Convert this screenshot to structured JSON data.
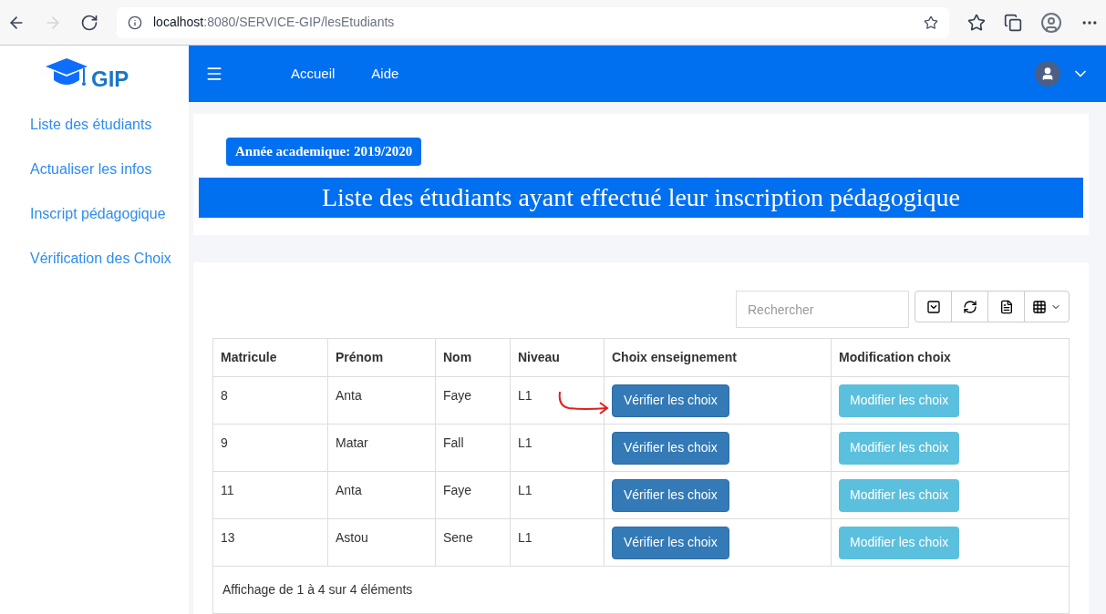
{
  "browser": {
    "url_host": "localhost",
    "url_rest": ":8080/SERVICE-GIP/lesEtudiants"
  },
  "logo": {
    "text": "GIP"
  },
  "sidebar": {
    "items": [
      {
        "label": "Liste des étudiants"
      },
      {
        "label": "Actualiser les infos"
      },
      {
        "label": "Inscript pédagogique"
      },
      {
        "label": "Vérification des Choix"
      }
    ]
  },
  "navbar": {
    "links": [
      "Accueil",
      "Aide"
    ]
  },
  "header": {
    "badge": "Année academique: 2019/2020",
    "title": "Liste des étudiants ayant effectué leur inscription pédagogique"
  },
  "search": {
    "placeholder": "Rechercher"
  },
  "table": {
    "columns": [
      "Matricule",
      "Prénom",
      "Nom",
      "Niveau",
      "Choix enseignement",
      "Modification choix"
    ],
    "rows": [
      {
        "cells": [
          "8",
          "Anta",
          "Faye",
          "L1"
        ],
        "verify": "Vérifier les choix",
        "modify": "Modifier les choix",
        "annotated": true
      },
      {
        "cells": [
          "9",
          "Matar",
          "Fall",
          "L1"
        ],
        "verify": "Vérifier les choix",
        "modify": "Modifier les choix",
        "annotated": false
      },
      {
        "cells": [
          "11",
          "Anta",
          "Faye",
          "L1"
        ],
        "verify": "Vérifier les choix",
        "modify": "Modifier les choix",
        "annotated": false
      },
      {
        "cells": [
          "13",
          "Astou",
          "Sene",
          "L1"
        ],
        "verify": "Vérifier les choix",
        "modify": "Modifier les choix",
        "annotated": false
      }
    ],
    "footer": "Affichage de 1 à 4 sur 4 éléments"
  }
}
